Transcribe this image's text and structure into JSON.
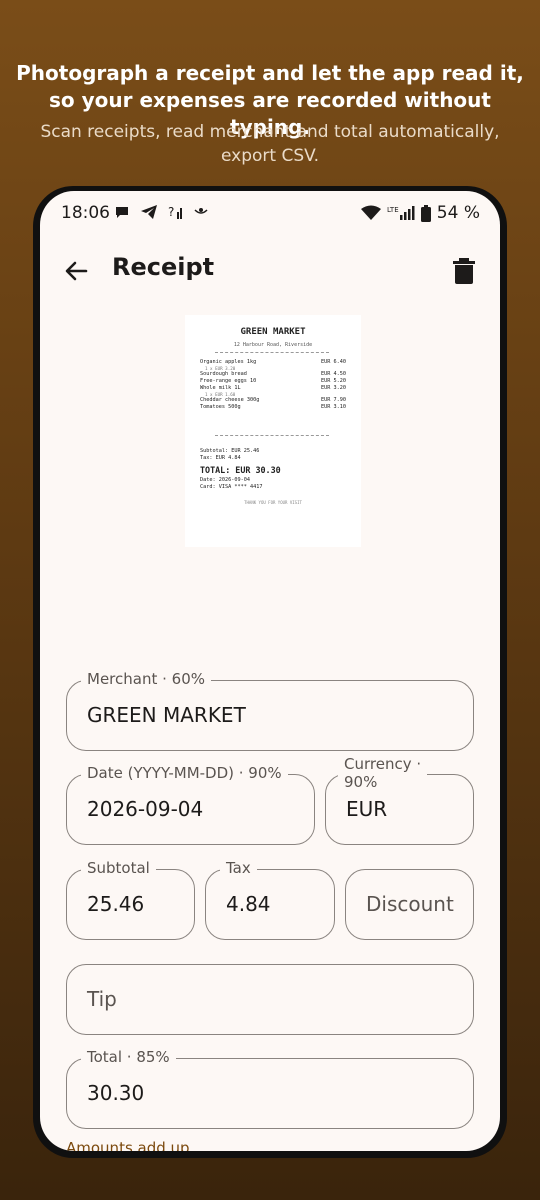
{
  "promo": {
    "headline_line1": "Photograph a receipt and let the app read it,",
    "headline_line2": "so your expenses are recorded without typing.",
    "sub_line1": "Scan receipts, read merchant and total automatically,",
    "sub_line2": "export CSV."
  },
  "status_bar": {
    "time": "18:06",
    "network": "LTE",
    "battery": "54 %",
    "icons_left": [
      "chat-bubble-icon",
      "telegram-icon",
      "no-signal-icon",
      "eye-icon"
    ],
    "icons_right": [
      "wifi-icon",
      "cell-signal-icon",
      "battery-icon"
    ]
  },
  "appbar": {
    "title": "Receipt",
    "back_icon": "arrow-back-icon",
    "delete_icon": "trash-icon"
  },
  "receipt_image": {
    "merchant": "GREEN MARKET",
    "address": "12 Harbour Road, Riverside",
    "items": [
      {
        "name": "Organic apples 1kg",
        "price": "EUR 6.40",
        "sub": "1 x EUR 3.20"
      },
      {
        "name": "Sourdough bread",
        "price": "EUR 4.50",
        "sub": ""
      },
      {
        "name": "Free-range eggs 10",
        "price": "EUR 5.20",
        "sub": ""
      },
      {
        "name": "Whole milk 1L",
        "price": "EUR 3.20",
        "sub": "1 x EUR 1.60"
      },
      {
        "name": "Cheddar cheese 300g",
        "price": "EUR 7.90",
        "sub": ""
      },
      {
        "name": "Tomatoes 500g",
        "price": "EUR 3.10",
        "sub": ""
      }
    ],
    "subtotal": "Subtotal: EUR 25.46",
    "tax": "Tax: EUR 4.84",
    "total": "TOTAL: EUR 30.30",
    "date": "Date: 2026-09-04",
    "card": "Card: VISA **** 4417",
    "thanks": "THANK YOU FOR YOUR VISIT"
  },
  "form": {
    "merchant": {
      "label": "Merchant · 60%",
      "value": "GREEN MARKET"
    },
    "date": {
      "label": "Date (YYYY-MM-DD) · 90%",
      "value": "2026-09-04"
    },
    "currency": {
      "label_line1": "Currency ·",
      "label_line2": "90%",
      "value": "EUR"
    },
    "subtotal": {
      "label": "Subtotal",
      "value": "25.46"
    },
    "tax": {
      "label": "Tax",
      "value": "4.84"
    },
    "discount": {
      "placeholder": "Discount"
    },
    "tip": {
      "placeholder": "Tip"
    },
    "total": {
      "label": "Total · 85%",
      "value": "30.30"
    },
    "helper": "Amounts add up"
  },
  "colors": {
    "background_top": "#7a4d18",
    "background_bottom": "#3a240c",
    "screen": "#fdf8f5",
    "outline": "#8a8480",
    "accent_text": "#7c4a0e"
  }
}
